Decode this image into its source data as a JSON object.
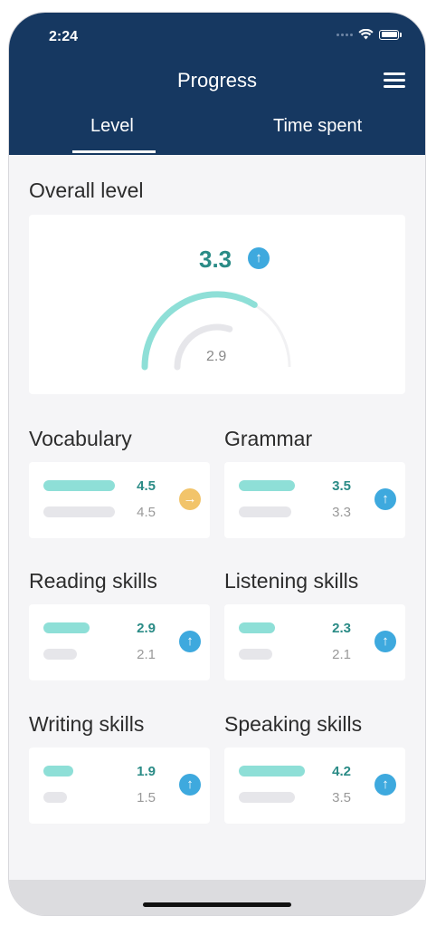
{
  "status_bar": {
    "time": "2:24"
  },
  "header": {
    "title": "Progress",
    "tabs": [
      {
        "label": "Level",
        "active": true
      },
      {
        "label": "Time spent",
        "active": false
      }
    ]
  },
  "overall": {
    "title": "Overall level",
    "current": "3.3",
    "previous": "2.9",
    "trend": "up"
  },
  "skills": [
    {
      "name": "Vocabulary",
      "current": "4.5",
      "previous": "4.5",
      "trend": "same",
      "current_fraction": 0.79,
      "previous_fraction": 0.79
    },
    {
      "name": "Grammar",
      "current": "3.5",
      "previous": "3.3",
      "trend": "up",
      "current_fraction": 0.62,
      "previous_fraction": 0.58
    },
    {
      "name": "Reading skills",
      "current": "2.9",
      "previous": "2.1",
      "trend": "up",
      "current_fraction": 0.51,
      "previous_fraction": 0.37
    },
    {
      "name": "Listening skills",
      "current": "2.3",
      "previous": "2.1",
      "trend": "up",
      "current_fraction": 0.4,
      "previous_fraction": 0.37
    },
    {
      "name": "Writing skills",
      "current": "1.9",
      "previous": "1.5",
      "trend": "up",
      "current_fraction": 0.33,
      "previous_fraction": 0.26
    },
    {
      "name": "Speaking skills",
      "current": "4.2",
      "previous": "3.5",
      "trend": "up",
      "current_fraction": 0.73,
      "previous_fraction": 0.62
    }
  ],
  "icons": {
    "trend_up": "arrow-up-circle-icon",
    "trend_same": "arrow-right-circle-icon"
  },
  "colors": {
    "header": "#163861",
    "current": "#2a8b86",
    "current_bar": "#8edfd7",
    "up": "#3ea9de",
    "same": "#f2c46a",
    "previous_bar": "#e6e6ea"
  }
}
